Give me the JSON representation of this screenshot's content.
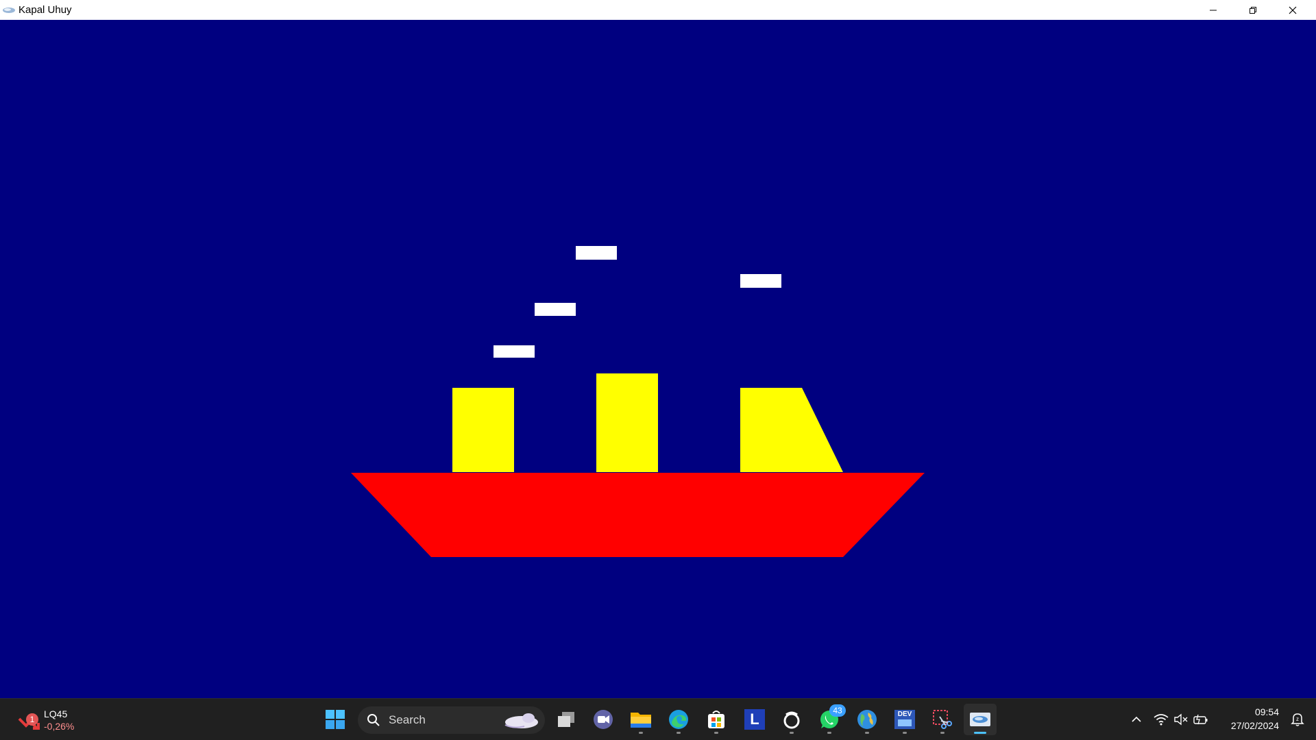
{
  "window": {
    "title": "Kapal Uhuy",
    "icon": "app-icon",
    "controls": [
      "minimize-icon",
      "restore-icon",
      "close-icon"
    ]
  },
  "scene": {
    "background_color": "#000080",
    "hull_color": "#ff0000",
    "funnel_color": "#ffff00",
    "smoke_color": "#ffffff"
  },
  "taskbar": {
    "widget": {
      "badge": "1",
      "name": "LQ45",
      "value": "-0,26%"
    },
    "search_label": "Search",
    "apps": [
      {
        "name": "start-button",
        "icon": "windows-logo-icon"
      },
      {
        "name": "task-view-button",
        "icon": "task-view-icon"
      },
      {
        "name": "meet-button",
        "icon": "video-camera-icon"
      },
      {
        "name": "file-explorer-button",
        "icon": "folder-icon"
      },
      {
        "name": "edge-button",
        "icon": "edge-icon"
      },
      {
        "name": "store-button",
        "icon": "store-icon"
      },
      {
        "name": "l-app-button",
        "icon": "l-icon",
        "label": "L"
      },
      {
        "name": "ring-app-button",
        "icon": "ring-icon"
      },
      {
        "name": "whatsapp-button",
        "icon": "whatsapp-icon",
        "badge": "43"
      },
      {
        "name": "globe-app-button",
        "icon": "globe-icon"
      },
      {
        "name": "devcpp-button",
        "icon": "dev-icon",
        "label": "DEV"
      },
      {
        "name": "snipping-tool-button",
        "icon": "scissors-icon"
      },
      {
        "name": "kapal-uhuy-taskbar-button",
        "icon": "app-icon"
      }
    ],
    "tray": {
      "icons": [
        "chevron-up-icon",
        "wifi-icon",
        "speaker-muted-icon",
        "battery-icon",
        "notification-icon"
      ]
    },
    "time": "09:54",
    "date": "27/02/2024"
  }
}
